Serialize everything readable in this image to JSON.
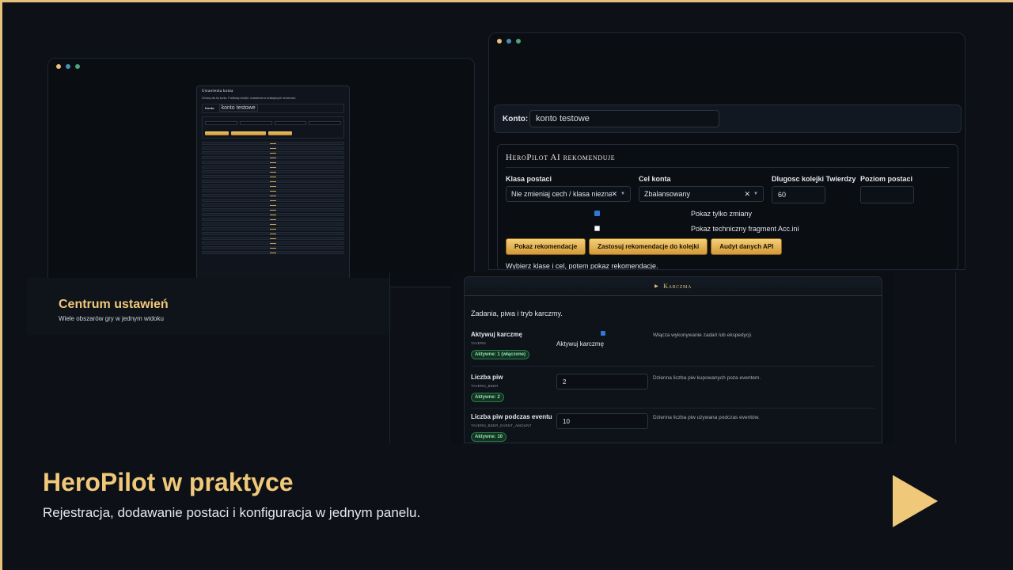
{
  "left_window": {
    "mini_title": "Ustawienia konta",
    "mini_text": "Zmiany dla tej konta. Podklady kolejki i ustawienia w dzialajacych serwerach.",
    "mini_konto_label": "Konto",
    "mini_konto_value": "konto testowe"
  },
  "caption": {
    "title": "Centrum ustawień",
    "subtitle": "Wiele obszarów gry w jednym widoku"
  },
  "right_window": {
    "konto_label": "Konto:",
    "konto_value": "konto testowe",
    "rec_title": "HeroPilot AI rekomenduje",
    "fields": {
      "klasa_label": "Klasa postaci",
      "klasa_value": "Nie zmieniaj cech / klasa nieznana",
      "cel_label": "Cel konta",
      "cel_value": "Zbalansowany",
      "kolejka_label": "Dlugosc kolejki Twierdzy",
      "kolejka_value": "60",
      "poziom_label": "Poziom postaci",
      "poziom_value": ""
    },
    "checkboxes": {
      "tylko_zmiany": "Pokaz tylko zmiany",
      "fragment": "Pokaz techniczny fragment Acc.ini"
    },
    "buttons": {
      "pokaz": "Pokaz rekomendacje",
      "zastosuj": "Zastosuj rekomendacje do kolejki",
      "audyt": "Audyt danych API"
    },
    "hint": "Wybierz klase i cel, potem pokaz rekomendacje."
  },
  "karczma": {
    "header": "Karczma",
    "desc": "Zadania, piwa i tryb karczmy.",
    "rows": [
      {
        "name": "Aktywuj karczmę",
        "key": "TAVERN",
        "badge": "Aktywne: 1 (włączone)",
        "control_label": "Aktywuj karczmę",
        "help": "Włącza wykonywanie zadań lub ekspedycji."
      },
      {
        "name": "Liczba piw",
        "key": "TAVERN_BEER",
        "badge": "Aktywne: 2",
        "value": "2",
        "help": "Dzienna liczba piw kupowanych poza eventem."
      },
      {
        "name": "Liczba piw podczas eventu",
        "key": "TAVERN_BEER_EVENT_AMOUNT",
        "badge": "Aktywne: 10",
        "value": "10",
        "help": "Dzienna liczba piw używana podczas eventów."
      }
    ]
  },
  "band": {
    "title": "HeroPilot w praktyce",
    "subtitle": "Rejestracja, dodawanie postaci i konfiguracja w jednym panelu."
  },
  "colors": {
    "accent": "#f0c87a",
    "background": "#0d1117",
    "badge_green": "#8ee0a8"
  }
}
